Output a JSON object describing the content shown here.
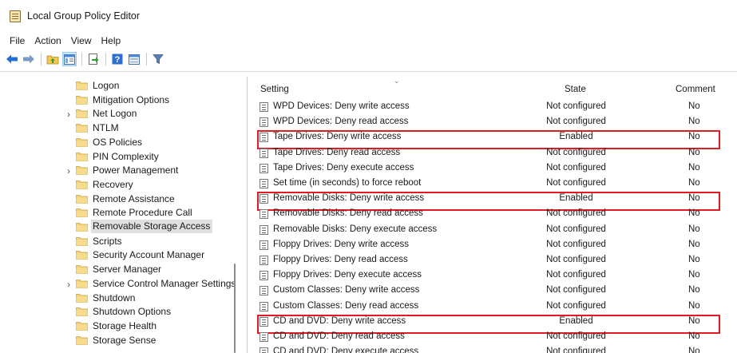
{
  "window": {
    "title": "Local Group Policy Editor"
  },
  "menu": [
    "File",
    "Action",
    "View",
    "Help"
  ],
  "toolbar": {
    "buttons": [
      "back-icon",
      "forward-icon",
      "up-folder-icon",
      "show-hide-tree-icon",
      "export-list-icon",
      "help-icon",
      "properties-icon",
      "filter-icon"
    ]
  },
  "tree": {
    "items": [
      {
        "label": "Logon",
        "expandable": false,
        "selected": false
      },
      {
        "label": "Mitigation Options",
        "expandable": false,
        "selected": false
      },
      {
        "label": "Net Logon",
        "expandable": true,
        "selected": false
      },
      {
        "label": "NTLM",
        "expandable": false,
        "selected": false
      },
      {
        "label": "OS Policies",
        "expandable": false,
        "selected": false
      },
      {
        "label": "PIN Complexity",
        "expandable": false,
        "selected": false
      },
      {
        "label": "Power Management",
        "expandable": true,
        "selected": false
      },
      {
        "label": "Recovery",
        "expandable": false,
        "selected": false
      },
      {
        "label": "Remote Assistance",
        "expandable": false,
        "selected": false
      },
      {
        "label": "Remote Procedure Call",
        "expandable": false,
        "selected": false
      },
      {
        "label": "Removable Storage Access",
        "expandable": false,
        "selected": true
      },
      {
        "label": "Scripts",
        "expandable": false,
        "selected": false
      },
      {
        "label": "Security Account Manager",
        "expandable": false,
        "selected": false
      },
      {
        "label": "Server Manager",
        "expandable": false,
        "selected": false
      },
      {
        "label": "Service Control Manager Settings",
        "expandable": true,
        "selected": false
      },
      {
        "label": "Shutdown",
        "expandable": false,
        "selected": false
      },
      {
        "label": "Shutdown Options",
        "expandable": false,
        "selected": false
      },
      {
        "label": "Storage Health",
        "expandable": false,
        "selected": false
      },
      {
        "label": "Storage Sense",
        "expandable": false,
        "selected": false
      }
    ]
  },
  "list": {
    "columns": {
      "setting": "Setting",
      "state": "State",
      "comment": "Comment"
    },
    "rows": [
      {
        "setting": "WPD Devices: Deny write access",
        "state": "Not configured",
        "comment": "No",
        "highlighted": false
      },
      {
        "setting": "WPD Devices: Deny read access",
        "state": "Not configured",
        "comment": "No",
        "highlighted": false
      },
      {
        "setting": "Tape Drives: Deny write access",
        "state": "Enabled",
        "comment": "No",
        "highlighted": true
      },
      {
        "setting": "Tape Drives: Deny read access",
        "state": "Not configured",
        "comment": "No",
        "highlighted": false
      },
      {
        "setting": "Tape Drives: Deny execute access",
        "state": "Not configured",
        "comment": "No",
        "highlighted": false
      },
      {
        "setting": "Set time (in seconds) to force reboot",
        "state": "Not configured",
        "comment": "No",
        "highlighted": false
      },
      {
        "setting": "Removable Disks: Deny write access",
        "state": "Enabled",
        "comment": "No",
        "highlighted": true
      },
      {
        "setting": "Removable Disks: Deny read access",
        "state": "Not configured",
        "comment": "No",
        "highlighted": false
      },
      {
        "setting": "Removable Disks: Deny execute access",
        "state": "Not configured",
        "comment": "No",
        "highlighted": false
      },
      {
        "setting": "Floppy Drives: Deny write access",
        "state": "Not configured",
        "comment": "No",
        "highlighted": false
      },
      {
        "setting": "Floppy Drives: Deny read access",
        "state": "Not configured",
        "comment": "No",
        "highlighted": false
      },
      {
        "setting": "Floppy Drives: Deny execute access",
        "state": "Not configured",
        "comment": "No",
        "highlighted": false
      },
      {
        "setting": "Custom Classes: Deny write access",
        "state": "Not configured",
        "comment": "No",
        "highlighted": false
      },
      {
        "setting": "Custom Classes: Deny read access",
        "state": "Not configured",
        "comment": "No",
        "highlighted": false
      },
      {
        "setting": "CD and DVD: Deny write access",
        "state": "Enabled",
        "comment": "No",
        "highlighted": true
      },
      {
        "setting": "CD and DVD: Deny read access",
        "state": "Not configured",
        "comment": "No",
        "highlighted": false
      },
      {
        "setting": "CD and DVD: Deny execute access",
        "state": "Not configured",
        "comment": "No",
        "highlighted": false
      }
    ]
  },
  "colors": {
    "highlight_border": "#e11b22",
    "selected_bg": "#e0e0e0",
    "folder": "#f3d27a"
  }
}
